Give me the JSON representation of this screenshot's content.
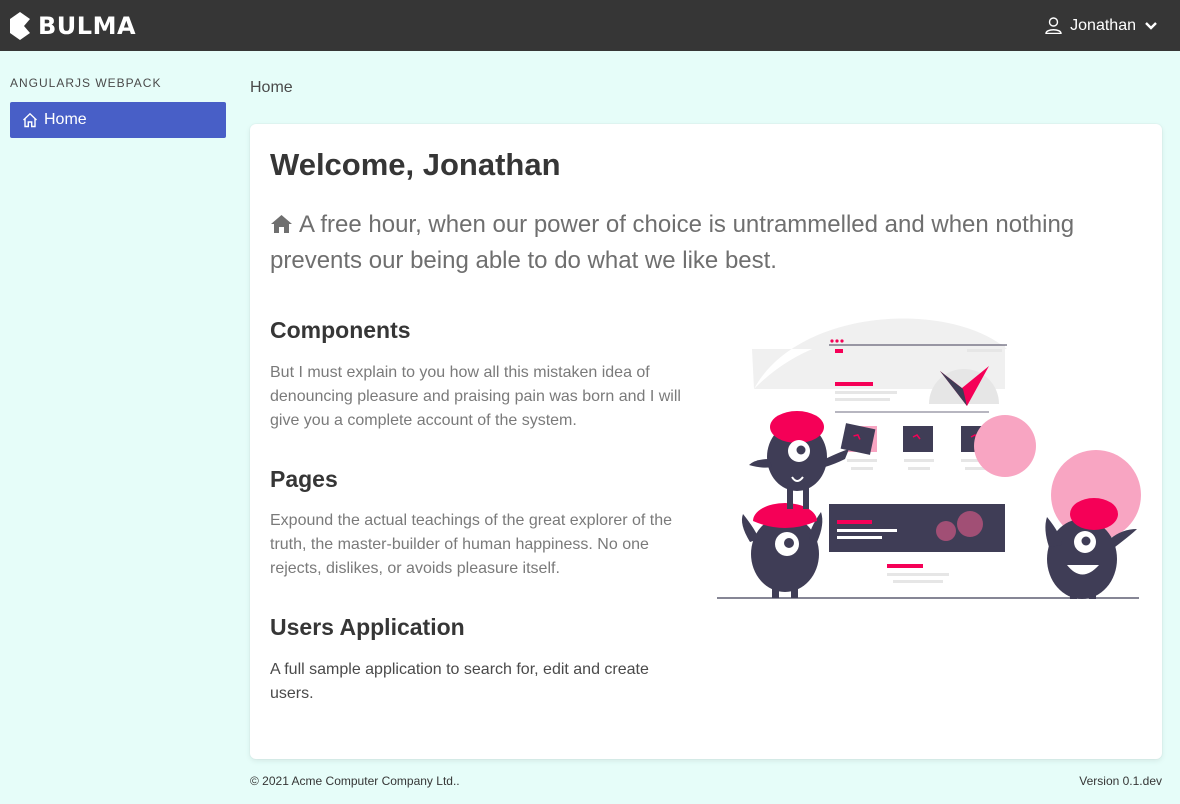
{
  "navbar": {
    "brand": "BULMA",
    "brand_icon": "bulma-logo-icon",
    "user_name": "Jonathan",
    "user_icon": "user-icon",
    "chevron_icon": "chevron-down-icon"
  },
  "sidebar": {
    "label": "AngularJS Webpack",
    "items": [
      {
        "label": "Home",
        "icon": "home-outline-icon",
        "active": true
      }
    ]
  },
  "breadcrumb": "Home",
  "main": {
    "title": "Welcome, Jonathan",
    "subtitle": "A free hour, when our power of choice is untrammelled and when nothing prevents our being able to do what we like best.",
    "sections": [
      {
        "title": "Components",
        "text": "But I must explain to you how all this mistaken idea of denouncing pleasure and praising pain was born and I will give you a complete account of the system."
      },
      {
        "title": "Pages",
        "text": "Expound the actual teachings of the great explorer of the truth, the master-builder of human happiness. No one rejects, dislikes, or avoids pleasure itself."
      },
      {
        "title": "Users Application",
        "text": "A full sample application to search for, edit and create users."
      }
    ]
  },
  "footer": {
    "copyright": "© 2021 Acme Computer Company Ltd..",
    "version": "Version 0.1.dev"
  },
  "colors": {
    "navbar": "#363636",
    "accent": "#485fc7",
    "background": "#e6fdf9",
    "illustration_accent": "#f50057",
    "illustration_dark": "#3f3d56"
  }
}
